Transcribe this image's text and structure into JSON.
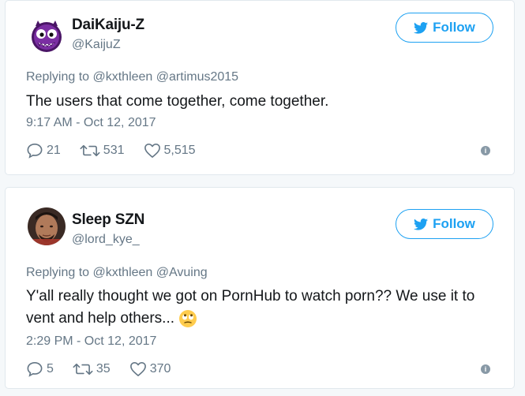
{
  "tweets": [
    {
      "name": "DaiKaiju-Z",
      "handle": "@KaijuZ",
      "follow_label": "Follow",
      "replying": "Replying to @kxthleen @artimus2015",
      "text": "The users that come together, come together.",
      "timestamp": "9:17 AM - Oct 12, 2017",
      "replies": "21",
      "retweets": "531",
      "likes": "5,515",
      "avatar_icon": "purple-monster-avatar"
    },
    {
      "name": "Sleep SZN",
      "handle": "@lord_kye_",
      "follow_label": "Follow",
      "replying": "Replying to @kxthleen @Avuing",
      "text": "Y'all really thought we got on PornHub to watch porn?? We use it to vent and help others...",
      "emoji": "eye-roll-emoji",
      "timestamp": "2:29 PM - Oct 12, 2017",
      "replies": "5",
      "retweets": "35",
      "likes": "370",
      "avatar_icon": "profile-photo-avatar"
    }
  ],
  "colors": {
    "accent": "#1da1f2",
    "text": "#14171a",
    "muted": "#657786",
    "border": "#e1e8ed"
  }
}
